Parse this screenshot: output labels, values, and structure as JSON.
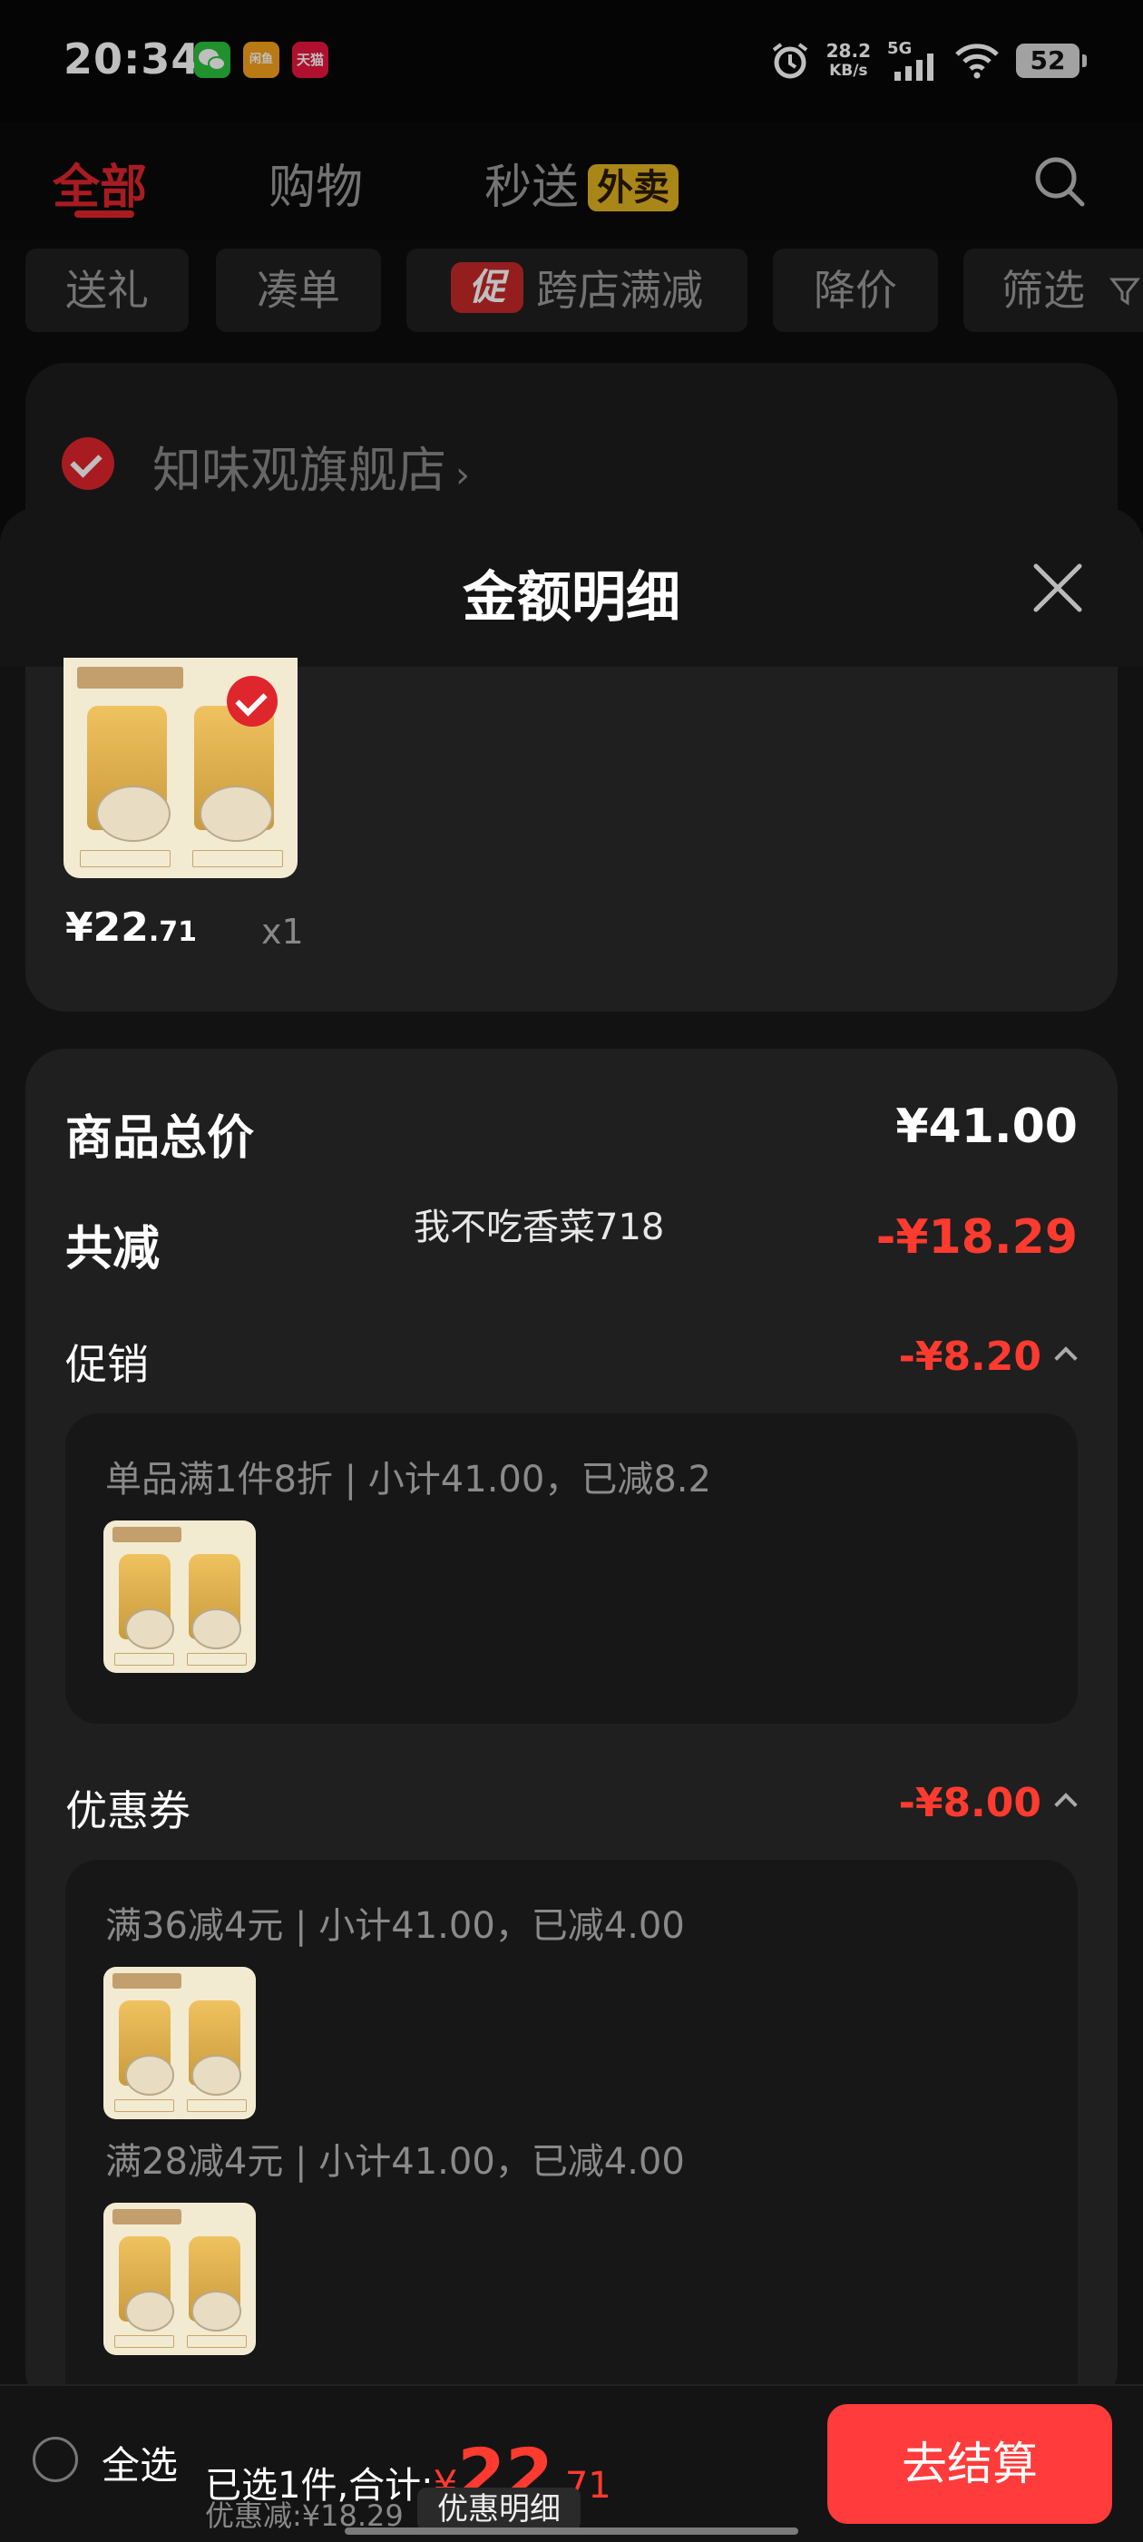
{
  "status_bar": {
    "time": "20:34",
    "net_speed_value": "28.2",
    "net_speed_unit": "KB/s",
    "signal": "5G",
    "battery": "52",
    "app_icons": [
      "wechat-icon",
      "xianyu-icon",
      "tmall-icon"
    ],
    "xianyu_label": "闲鱼",
    "tmall_label": "天猫"
  },
  "top_tabs": [
    {
      "label": "全部",
      "active": true
    },
    {
      "label": "购物",
      "active": false
    },
    {
      "label": "秒送",
      "active": false
    }
  ],
  "waimai_badge": "外卖",
  "filters": {
    "gift": "送礼",
    "combine": "凑单",
    "promo_tag": "促",
    "cross_store": "跨店满减",
    "price_drop": "降价",
    "filter": "筛选"
  },
  "store": {
    "name": "知味观旗舰店",
    "arrow": "›"
  },
  "sheet": {
    "title": "金额明细"
  },
  "item": {
    "price_main": "¥22",
    "price_decimal": ".71",
    "quantity": "x1"
  },
  "summary": {
    "total_label": "商品总价",
    "total_value": "¥41.00",
    "discount_label": "共减",
    "discount_value": "-¥18.29",
    "promo_label": "促销",
    "promo_value": "-¥8.20",
    "promo_detail": "单品满1件8折 | 小计41.00，已减8.2",
    "coupon_label": "优惠券",
    "coupon_value": "-¥8.00",
    "coupon_detail_1": "满36减4元 | 小计41.00，已减4.00",
    "coupon_detail_2": "满28减4元 | 小计41.00，已减4.00"
  },
  "watermark": "我不吃香菜718",
  "bottom": {
    "select_all": "全选",
    "selected_text": "已选1件,合计:",
    "currency": "¥",
    "total_main": "22",
    "total_decimal": ".71",
    "discount_text": "优惠减:¥18.29",
    "detail_button": "优惠明细",
    "checkout": "去结算"
  },
  "colors": {
    "accent_red": "#e0262d",
    "price_red": "#ff3b30",
    "waimai_yellow": "#e2b320",
    "background": "#0d0d0d"
  }
}
